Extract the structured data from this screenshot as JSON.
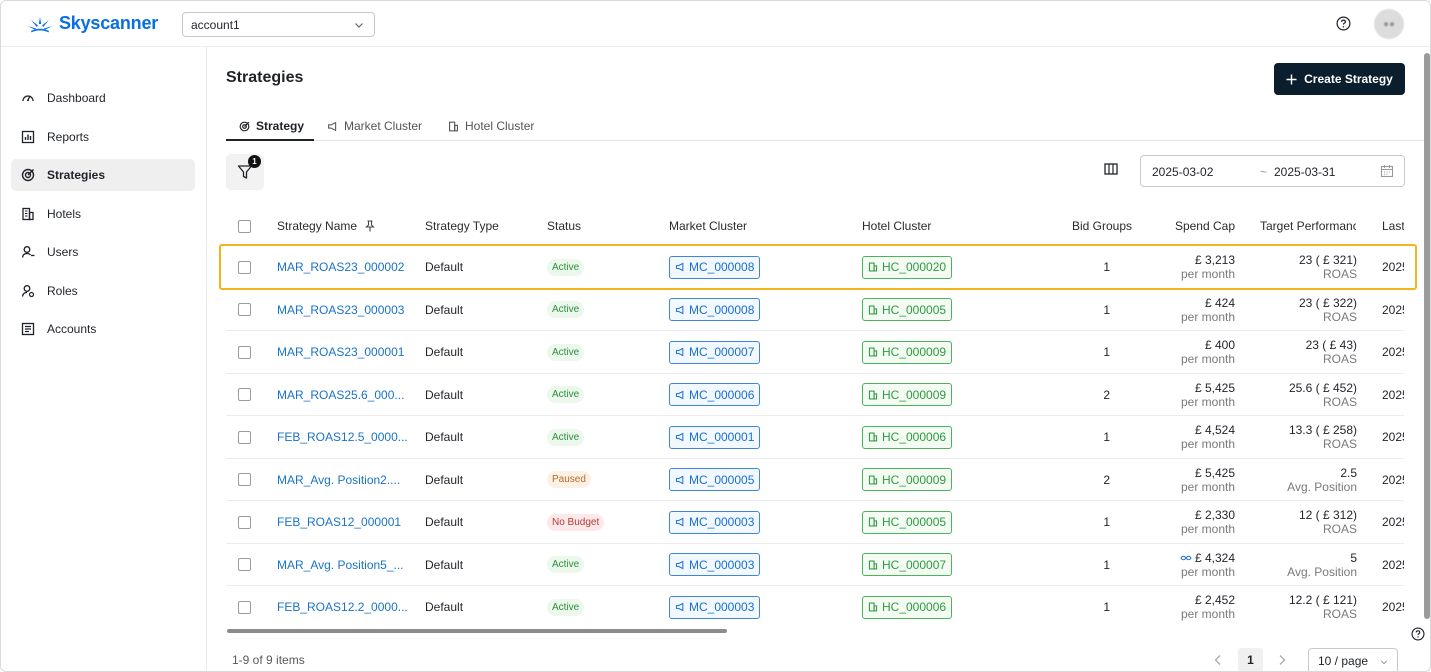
{
  "brand": {
    "name": "Skyscanner",
    "color": "#0770e3"
  },
  "account_select": {
    "value": "account1"
  },
  "sidebar": {
    "items": [
      {
        "label": "Dashboard",
        "icon": "dashboard-icon"
      },
      {
        "label": "Reports",
        "icon": "reports-icon"
      },
      {
        "label": "Strategies",
        "icon": "strategies-icon",
        "active": true
      },
      {
        "label": "Hotels",
        "icon": "hotels-icon"
      },
      {
        "label": "Users",
        "icon": "users-icon"
      },
      {
        "label": "Roles",
        "icon": "roles-icon"
      },
      {
        "label": "Accounts",
        "icon": "accounts-icon"
      }
    ]
  },
  "page": {
    "title": "Strategies",
    "create_label": "Create Strategy"
  },
  "tabs": [
    {
      "label": "Strategy",
      "active": true
    },
    {
      "label": "Market Cluster"
    },
    {
      "label": "Hotel Cluster"
    }
  ],
  "filter": {
    "badge": "1"
  },
  "date_range": {
    "start": "2025-03-02",
    "separator": "~",
    "end": "2025-03-31"
  },
  "table": {
    "columns": [
      "Strategy Name",
      "Strategy Type",
      "Status",
      "Market Cluster",
      "Hotel Cluster",
      "Bid Groups",
      "Spend Cap",
      "Target Performanc",
      "Last"
    ],
    "rows": [
      {
        "name": "MAR_ROAS23_000002",
        "type": "Default",
        "status": "Active",
        "status_kind": "active",
        "market": "MC_000008",
        "hotel": "HC_000020",
        "bid_groups": "1",
        "spend": "£ 3,213",
        "spend_sub": "per month",
        "target": "23 ( £ 321)",
        "target_sub": "ROAS",
        "last": "2025",
        "highlighted": true
      },
      {
        "name": "MAR_ROAS23_000003",
        "type": "Default",
        "status": "Active",
        "status_kind": "active",
        "market": "MC_000008",
        "hotel": "HC_000005",
        "bid_groups": "1",
        "spend": "£ 424",
        "spend_sub": "per month",
        "target": "23 ( £ 322)",
        "target_sub": "ROAS",
        "last": "2025"
      },
      {
        "name": "MAR_ROAS23_000001",
        "type": "Default",
        "status": "Active",
        "status_kind": "active",
        "market": "MC_000007",
        "hotel": "HC_000009",
        "bid_groups": "1",
        "spend": "£ 400",
        "spend_sub": "per month",
        "target": "23 ( £ 43)",
        "target_sub": "ROAS",
        "last": "2025"
      },
      {
        "name": "MAR_ROAS25.6_000...",
        "type": "Default",
        "status": "Active",
        "status_kind": "active",
        "market": "MC_000006",
        "hotel": "HC_000009",
        "bid_groups": "2",
        "spend": "£ 5,425",
        "spend_sub": "per month",
        "target": "25.6 ( £ 452)",
        "target_sub": "ROAS",
        "last": "2025"
      },
      {
        "name": "FEB_ROAS12.5_0000...",
        "type": "Default",
        "status": "Active",
        "status_kind": "active",
        "market": "MC_000001",
        "hotel": "HC_000006",
        "bid_groups": "1",
        "spend": "£ 4,524",
        "spend_sub": "per month",
        "target": "13.3 ( £ 258)",
        "target_sub": "ROAS",
        "last": "2025"
      },
      {
        "name": "MAR_Avg. Position2....",
        "type": "Default",
        "status": "Paused",
        "status_kind": "paused",
        "market": "MC_000005",
        "hotel": "HC_000009",
        "bid_groups": "2",
        "spend": "£ 5,425",
        "spend_sub": "per month",
        "target": "2.5",
        "target_sub": "Avg. Position",
        "last": "2025"
      },
      {
        "name": "FEB_ROAS12_000001",
        "type": "Default",
        "status": "No Budget",
        "status_kind": "nobudget",
        "market": "MC_000003",
        "hotel": "HC_000005",
        "bid_groups": "1",
        "spend": "£ 2,330",
        "spend_sub": "per month",
        "target": "12 ( £ 312)",
        "target_sub": "ROAS",
        "last": "2025"
      },
      {
        "name": "MAR_Avg. Position5_...",
        "type": "Default",
        "status": "Active",
        "status_kind": "active",
        "market": "MC_000003",
        "hotel": "HC_000007",
        "bid_groups": "1",
        "spend": "£ 4,324",
        "spend_sub": "per month",
        "target": "5",
        "target_sub": "Avg. Position",
        "last": "2025",
        "spend_icon": true
      },
      {
        "name": "FEB_ROAS12.2_0000...",
        "type": "Default",
        "status": "Active",
        "status_kind": "active",
        "market": "MC_000003",
        "hotel": "HC_000006",
        "bid_groups": "1",
        "spend": "£ 2,452",
        "spend_sub": "per month",
        "target": "12.2 ( £ 121)",
        "target_sub": "ROAS",
        "last": "2025"
      }
    ]
  },
  "footer": {
    "count": "1-9 of 9 items",
    "page": "1",
    "page_size": "10 / page"
  }
}
